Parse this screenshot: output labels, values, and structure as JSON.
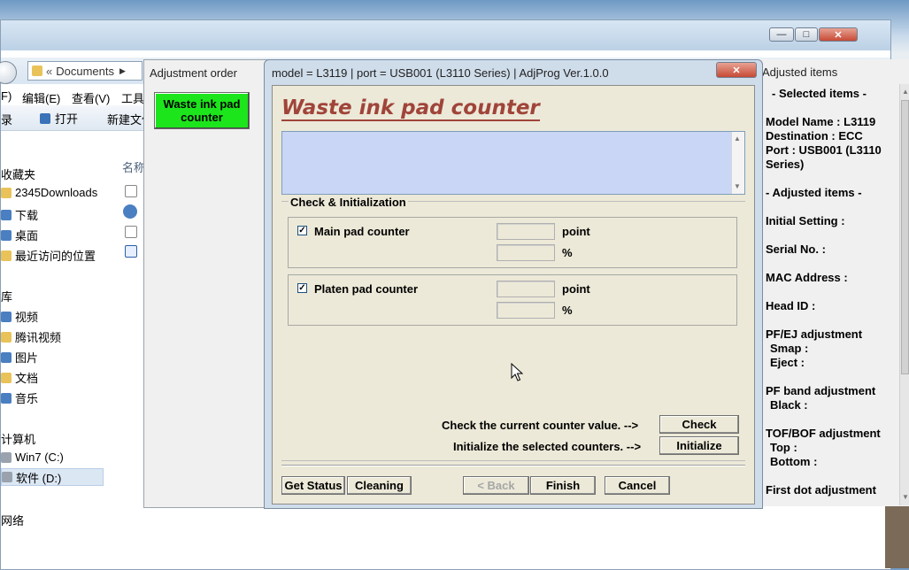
{
  "explorer": {
    "breadcrumb": "Documents",
    "menu": [
      "F)",
      "编辑(E)",
      "查看(V)",
      "工具"
    ],
    "toolbar": {
      "left_label": "录",
      "open_label": "打开",
      "new_folder_label": "新建文件"
    },
    "column_header": "名称",
    "favorites_header": "收藏夹",
    "favorites": [
      "2345Downloads",
      "下载",
      "桌面",
      "最近访问的位置"
    ],
    "library_header": "库",
    "libraries": [
      "视频",
      "腾讯视频",
      "图片",
      "文档",
      "音乐"
    ],
    "computer_header": "计算机",
    "drives": [
      "Win7 (C:)",
      "软件 (D:)"
    ],
    "network_header": "网络"
  },
  "adjustment_order": {
    "header": "Adjustment order",
    "item_label": "Waste ink pad counter"
  },
  "dialog": {
    "title": "model = L3119 | port = USB001 (L3110 Series) | AdjProg Ver.1.0.0",
    "close_glyph": "✕",
    "heading": "Waste ink pad counter",
    "group_legend": "Check & Initialization",
    "main_pad": {
      "label": "Main pad counter",
      "checked": true,
      "unit_point": "point",
      "unit_percent": "%"
    },
    "platen_pad": {
      "label": "Platen pad counter",
      "checked": true,
      "unit_point": "point",
      "unit_percent": "%"
    },
    "check_prompt": "Check the current counter value. -->",
    "check_button": "Check",
    "init_prompt": "Initialize the selected counters. -->",
    "init_button": "Initialize",
    "buttons": {
      "get_status": "Get Status",
      "cleaning": "Cleaning",
      "back": "< Back",
      "finish": "Finish",
      "cancel": "Cancel"
    }
  },
  "adjusted_items": {
    "header": "Adjusted items",
    "selected_header": "- Selected items -",
    "model_name": "Model Name : L3119",
    "destination": "Destination : ECC",
    "port_line1": "Port : USB001 (L3110",
    "port_line2": "Series)",
    "adjusted_header": "- Adjusted items -",
    "initial_setting": "Initial Setting :",
    "serial_no": "Serial No. :",
    "mac_address": "MAC Address :",
    "head_id": "Head ID :",
    "pfej": "PF/EJ adjustment",
    "smap": "Smap :",
    "eject": "Eject :",
    "pf_band": "PF band adjustment",
    "black": "Black :",
    "tof_bof": "TOF/BOF adjustment",
    "top": "Top :",
    "bottom": "Bottom :",
    "first_dot": "First dot adjustment"
  },
  "colors": {
    "heading": "#a0443a",
    "order_button": "#1ce51c",
    "message_box": "#c9d6f5",
    "dialog_client": "#ece9d8"
  }
}
